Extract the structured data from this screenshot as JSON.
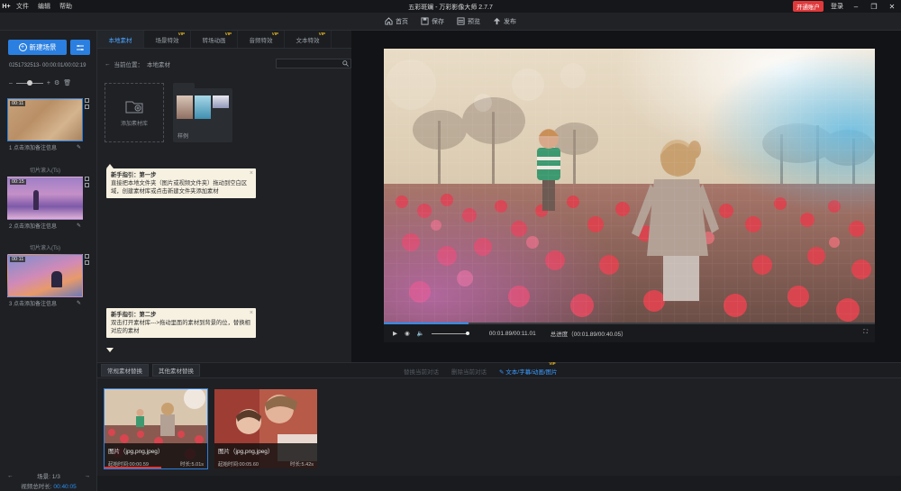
{
  "app": {
    "logo": "H+",
    "title": "五彩斑斓 - 万彩影像大师 2.7.7",
    "menu": [
      "文件",
      "编辑",
      "帮助"
    ],
    "open_account": "开通账户",
    "login": "登录"
  },
  "toolbar": {
    "home": "首页",
    "save": "保存",
    "preview": "预览",
    "publish": "发布"
  },
  "scenes": {
    "new_scene": "新建场景",
    "info": "0251732513-      00:00:01/00:02:19",
    "items": [
      {
        "duration": "00:11",
        "caption": "1  点击添加备注信息"
      },
      {
        "duration": "00:15",
        "caption": "2  点击添加备注信息"
      },
      {
        "duration": "00:11",
        "caption": "3  点击添加备注信息"
      }
    ],
    "transitions": [
      "切片滚入(Ts)",
      "切片滚入(Ts)"
    ],
    "nav": "场景: 1/3",
    "total_label": "视频总时长:",
    "total_value": "00:40:05"
  },
  "material": {
    "tabs": [
      {
        "label": "本地素材",
        "vip": ""
      },
      {
        "label": "场景特效",
        "vip": "VIP"
      },
      {
        "label": "转场动画",
        "vip": "VIP"
      },
      {
        "label": "音频特效",
        "vip": "VIP"
      },
      {
        "label": "文本特效",
        "vip": "VIP"
      }
    ],
    "path_label": "当前位置：",
    "path_value": "本地素材",
    "add_folder": "添加素材库",
    "folder_name": "样例"
  },
  "tips": {
    "step1": {
      "title": "新手指引：第一步",
      "body": "直接把本地文件夹（图片或视频文件夹）拖动到空白区域，创建素材库或点击新建文件夹添加素材"
    },
    "step2": {
      "title": "新手指引：第二步",
      "body": "双击打开素材库--->拖动里面的素材到背景的位，替换相对应的素材"
    }
  },
  "player": {
    "current": "00:01.89/00:11.01",
    "total": "总进度（00:01.89/00:40.05）",
    "progress_fraction": 0.172
  },
  "replace": {
    "tabs": [
      "常规素材替换",
      "其他素材替换"
    ],
    "actions": [
      "替换当前对话",
      "删除当前对话",
      "文本/字幕/动画/图片"
    ],
    "action_vip": "VIP",
    "cards": [
      {
        "type": "图片（jpg,png,jpeg）",
        "start": "起始时间:00:00.59",
        "duration": "时长:5.01s",
        "bar_fraction": 0.55
      },
      {
        "type": "图片（jpg,png,jpeg）",
        "start": "起始时间:00:05.60",
        "duration": "时长:5.42s",
        "bar_fraction": 0.0
      }
    ]
  },
  "colors": {
    "accent": "#2a7fe0",
    "danger": "#e0393b",
    "vip": "#e7b825",
    "tip_bg": "#f7f1e2"
  }
}
